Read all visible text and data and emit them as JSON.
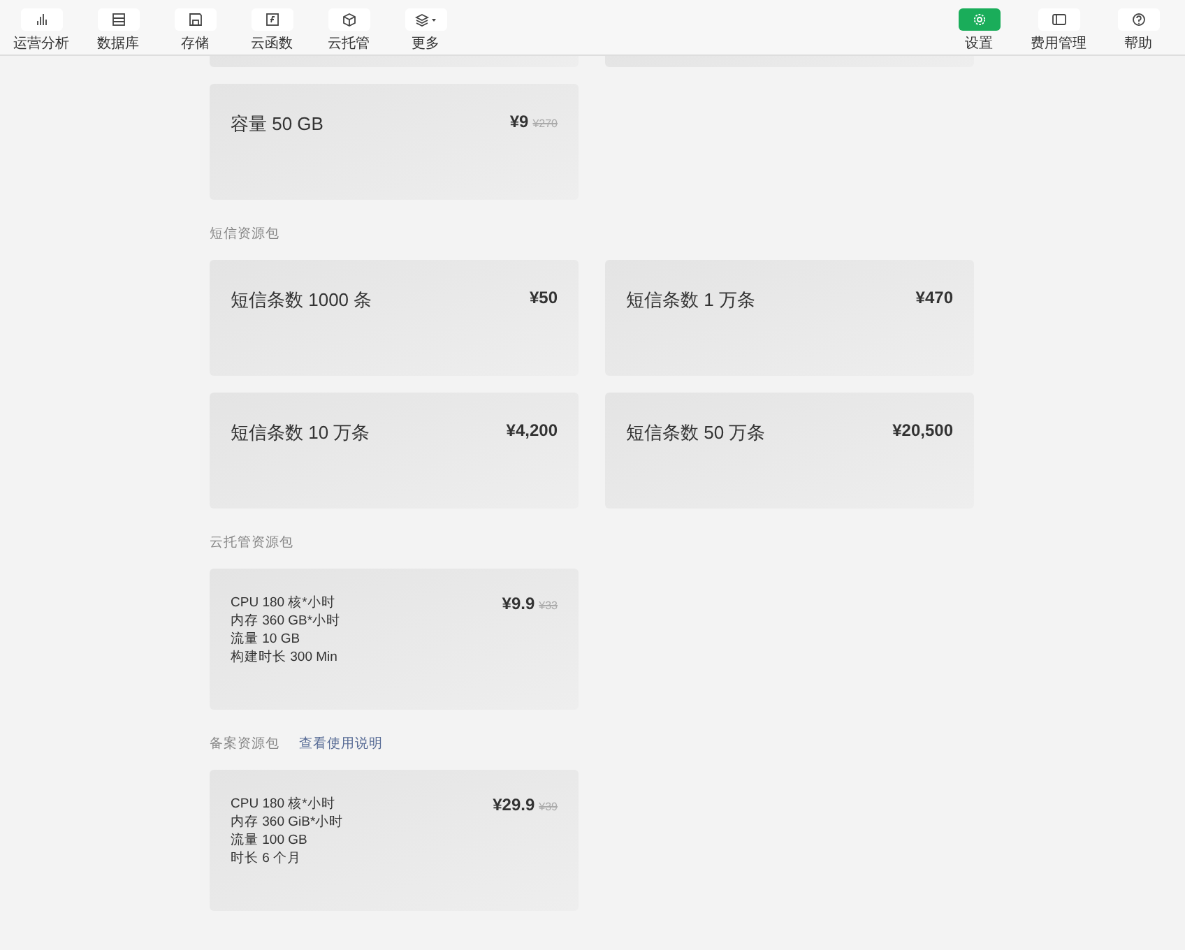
{
  "toolbar_left": [
    {
      "label": "运营分析",
      "kind": "chart",
      "selected": false
    },
    {
      "label": "数据库",
      "kind": "table",
      "selected": false
    },
    {
      "label": "存储",
      "kind": "disk",
      "selected": false
    },
    {
      "label": "云函数",
      "kind": "func",
      "selected": false
    },
    {
      "label": "云托管",
      "kind": "cube",
      "selected": false
    },
    {
      "label": "更多",
      "kind": "layers",
      "selected": false
    }
  ],
  "toolbar_right": [
    {
      "label": "设置",
      "kind": "gear",
      "selected": true
    },
    {
      "label": "费用管理",
      "kind": "panel",
      "selected": false
    },
    {
      "label": "帮助",
      "kind": "help",
      "selected": false
    }
  ],
  "sections": [
    {
      "cards": [
        {
          "kind": "cut"
        },
        {
          "kind": "cut"
        }
      ]
    },
    {
      "cards": [
        {
          "kind": "simple",
          "lines": [
            "容量 50 GB"
          ],
          "price": "¥9",
          "old_price": "¥270"
        }
      ]
    },
    {
      "title": "短信资源包",
      "cards": [
        {
          "kind": "simple",
          "lines": [
            "短信条数 1000 条"
          ],
          "price": "¥50"
        },
        {
          "kind": "simple",
          "lines": [
            "短信条数 1 万条"
          ],
          "price": "¥470"
        },
        {
          "kind": "simple",
          "lines": [
            "短信条数 10 万条"
          ],
          "price": "¥4,200"
        },
        {
          "kind": "simple",
          "lines": [
            "短信条数 50 万条"
          ],
          "price": "¥20,500"
        }
      ]
    },
    {
      "title": "云托管资源包",
      "cards": [
        {
          "kind": "multi",
          "lines": [
            "CPU 180 核*小时",
            "内存 360 GB*小时",
            "流量 10 GB",
            "构建时长 300 Min"
          ],
          "price": "¥9.9",
          "old_price": "¥33"
        }
      ]
    },
    {
      "title": "备案资源包",
      "link": "查看使用说明",
      "cards": [
        {
          "kind": "multi",
          "lines": [
            "CPU 180 核*小时",
            "内存 360 GiB*小时",
            "流量 100 GB",
            "时长 6 个月"
          ],
          "price": "¥29.9",
          "old_price": "¥39"
        }
      ]
    }
  ]
}
